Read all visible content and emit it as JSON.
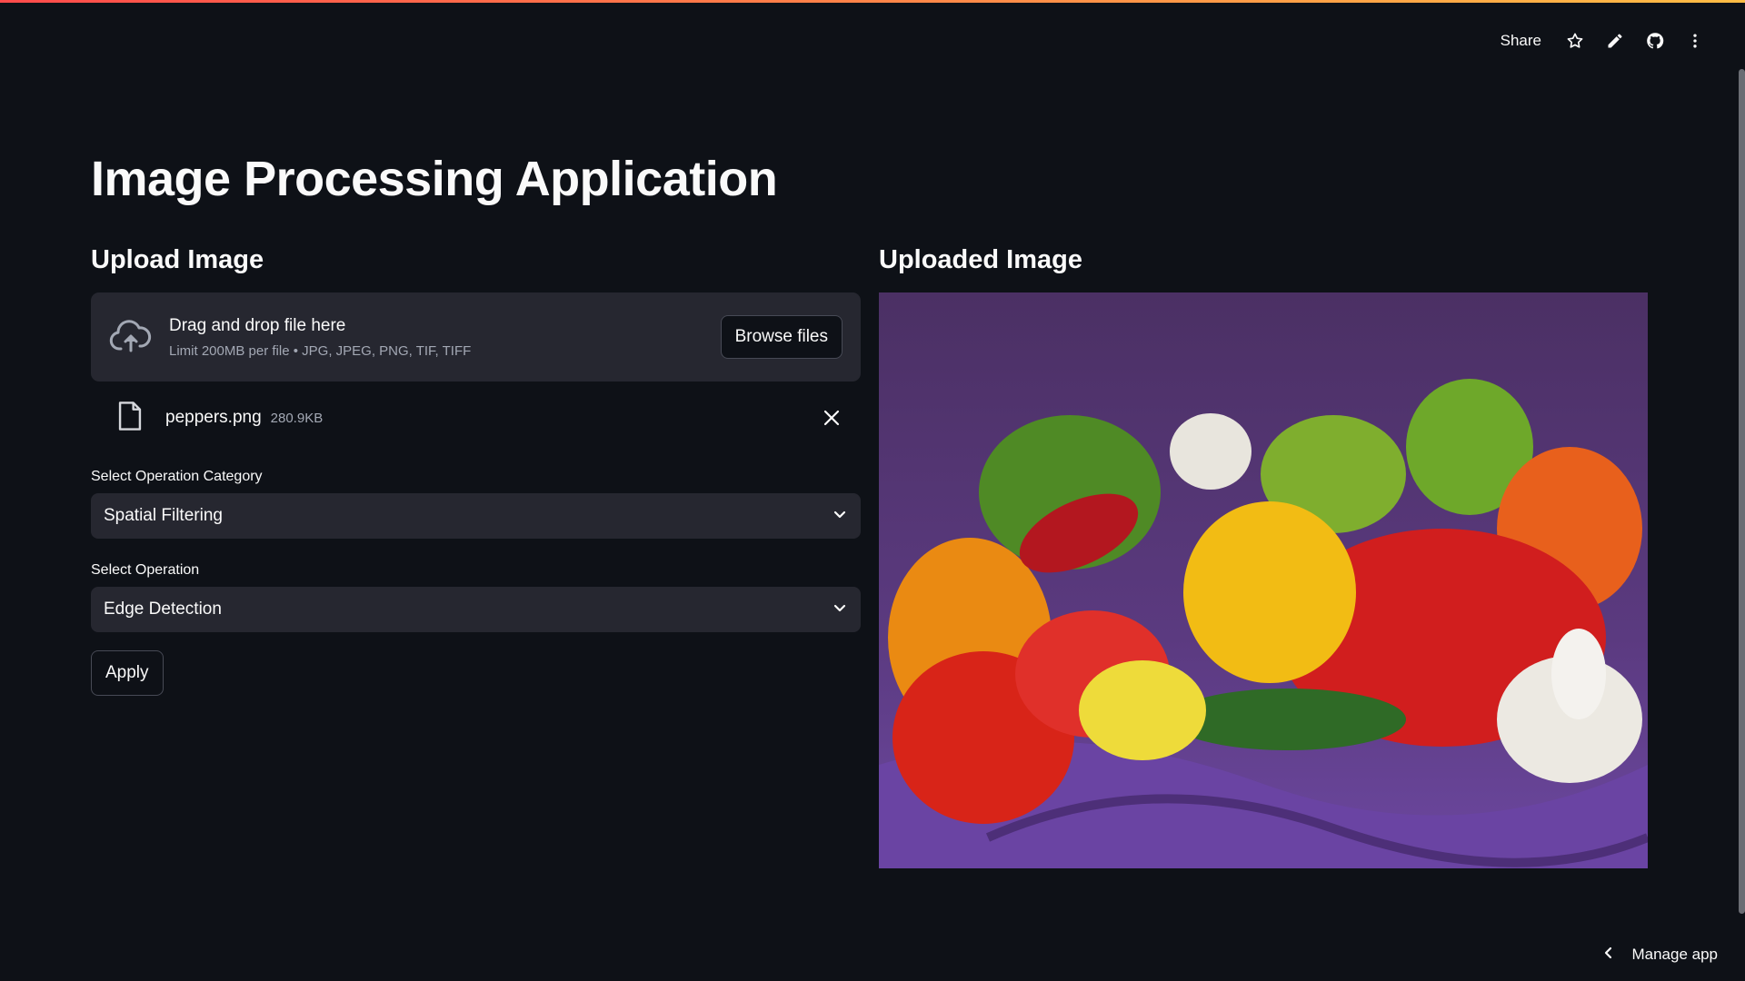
{
  "header": {
    "share_label": "Share",
    "icons": [
      "star-icon",
      "pencil-icon",
      "github-icon",
      "more-vertical-icon"
    ]
  },
  "page": {
    "title": "Image Processing Application"
  },
  "upload": {
    "heading": "Upload Image",
    "dropzone_text": "Drag and drop file here",
    "dropzone_limit": "Limit 200MB per file • JPG, JPEG, PNG, TIF, TIFF",
    "browse_label": "Browse files",
    "file_name": "peppers.png",
    "file_size": "280.9KB"
  },
  "controls": {
    "category_label": "Select Operation Category",
    "category_value": "Spatial Filtering",
    "operation_label": "Select Operation",
    "operation_value": "Edge Detection",
    "apply_label": "Apply"
  },
  "preview": {
    "heading": "Uploaded Image"
  },
  "footer": {
    "manage_label": "Manage app"
  },
  "colors": {
    "background": "#0e1117",
    "surface": "#262730",
    "accent_gradient_start": "#ff4b4b",
    "accent_gradient_end": "#ffbd45"
  }
}
